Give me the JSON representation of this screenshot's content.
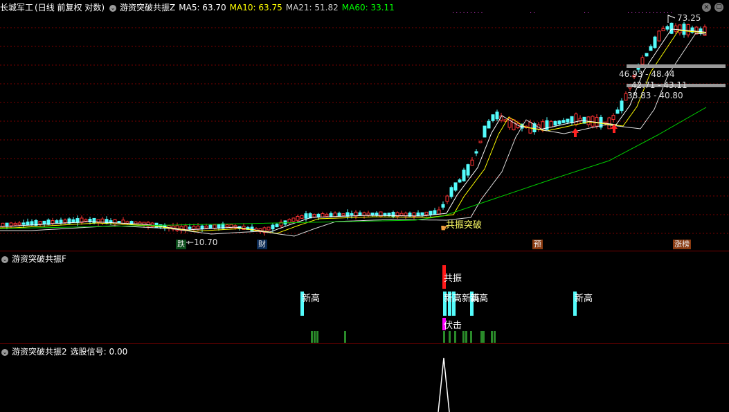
{
  "header": {
    "stock": "长城军工",
    "period": "(日线 前复权 对数)",
    "indicator": "游资突破共振Z",
    "ma5": "MA5: 63.70",
    "ma10": "MA10: 63.75",
    "ma21": "MA21: 51.82",
    "ma60": "MA60: 33.11"
  },
  "main_labels": {
    "low_price": "←10.70",
    "high_price": "73.25",
    "breakout": "共振突破",
    "band1": "46.93 - 48.44",
    "band2": "42.71 - 43.11",
    "band3": "38.83 - 40.80"
  },
  "bottom_tags": {
    "fall": "跌",
    "cai": "财",
    "yu": "预",
    "limit_up": "涨榜"
  },
  "pane_f": {
    "title": "游资突破共振F",
    "gongzhen": "共振",
    "xingao1": "新高",
    "xingao2": "新高",
    "xingao_multi": "新高新高",
    "xingao3": "新高",
    "fuji": "伏击"
  },
  "pane_2": {
    "title": "游资突破共振2",
    "signal": "选股信号: 0.00"
  },
  "colors": {
    "up": "#ff3333",
    "down": "#54fcfc",
    "ma5": "#ffffff",
    "ma10": "#ffff00",
    "ma21": "#e0e0e0",
    "ma60": "#00cc00",
    "grid": "#7a0000"
  }
}
